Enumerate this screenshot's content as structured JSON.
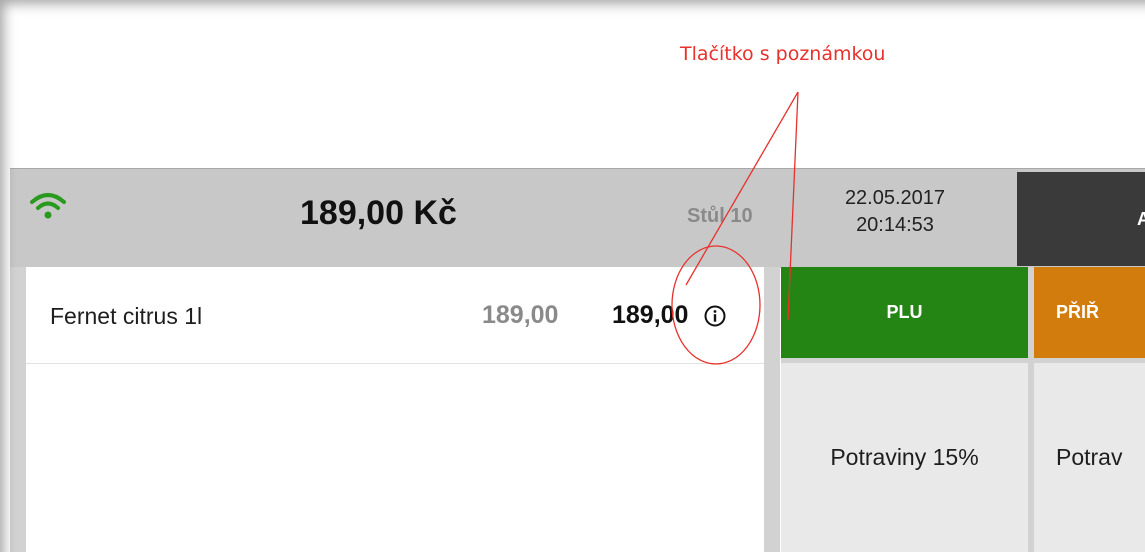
{
  "annotation": {
    "label": "Tlačítko s poznámkou",
    "color": "#e8312c"
  },
  "header": {
    "total": "189,00 Kč",
    "table": "Stůl 10",
    "date": "22.05.2017",
    "time": "20:14:53",
    "dark_button_label": "AD",
    "wifi_icon": "wifi-icon",
    "wifi_color": "#2a9a1e"
  },
  "order": {
    "items": [
      {
        "name": "Fernet citrus 1l",
        "unit_price": "189,00",
        "total": "189,00",
        "note_icon": "info-icon"
      }
    ]
  },
  "buttons": {
    "plu": {
      "label": "PLU",
      "color": "#248514"
    },
    "assign": {
      "label": "PŘIŘ",
      "color": "#d17c0d"
    }
  },
  "categories": [
    {
      "label": "Potraviny 15%"
    },
    {
      "label": "Potrav"
    }
  ]
}
